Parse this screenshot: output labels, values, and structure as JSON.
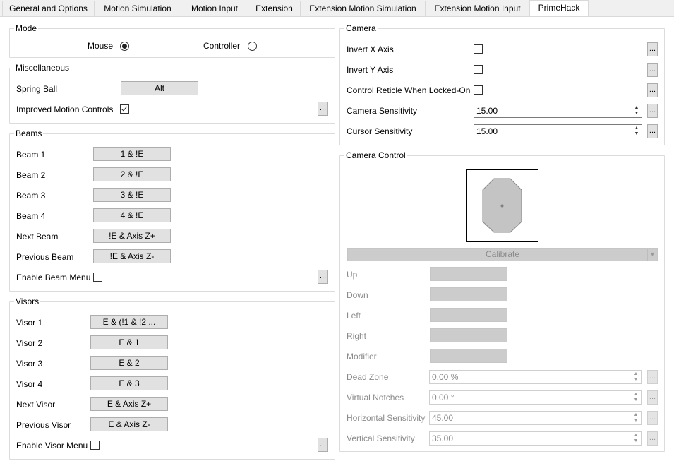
{
  "tabs": [
    {
      "label": "General and Options"
    },
    {
      "label": "Motion Simulation"
    },
    {
      "label": "Motion Input"
    },
    {
      "label": "Extension"
    },
    {
      "label": "Extension Motion Simulation"
    },
    {
      "label": "Extension Motion Input"
    },
    {
      "label": "PrimeHack"
    }
  ],
  "mode": {
    "title": "Mode",
    "mouse_label": "Mouse",
    "controller_label": "Controller",
    "selected": "Mouse"
  },
  "misc": {
    "title": "Miscellaneous",
    "spring_ball_label": "Spring Ball",
    "spring_ball_value": "Alt",
    "improved_motion_label": "Improved Motion Controls",
    "improved_motion_checked": true,
    "more_label": "..."
  },
  "beams": {
    "title": "Beams",
    "rows": [
      {
        "label": "Beam 1",
        "value": "1 & !E"
      },
      {
        "label": "Beam 2",
        "value": "2 & !E"
      },
      {
        "label": "Beam 3",
        "value": "3 & !E"
      },
      {
        "label": "Beam 4",
        "value": "4 & !E"
      },
      {
        "label": "Next Beam",
        "value": "!E & Axis Z+"
      },
      {
        "label": "Previous Beam",
        "value": "!E & Axis Z-"
      }
    ],
    "menu_label": "Enable Beam Menu",
    "menu_checked": false,
    "more_label": "..."
  },
  "visors": {
    "title": "Visors",
    "rows": [
      {
        "label": "Visor 1",
        "value": "E & (!1 & !2 ..."
      },
      {
        "label": "Visor 2",
        "value": "E & 1"
      },
      {
        "label": "Visor 3",
        "value": "E & 2"
      },
      {
        "label": "Visor 4",
        "value": "E & 3"
      },
      {
        "label": "Next Visor",
        "value": "E & Axis Z+"
      },
      {
        "label": "Previous Visor",
        "value": "E & Axis Z-"
      }
    ],
    "menu_label": "Enable Visor Menu",
    "menu_checked": false,
    "more_label": "..."
  },
  "camera": {
    "title": "Camera",
    "invert_x_label": "Invert X Axis",
    "invert_y_label": "Invert Y Axis",
    "reticle_label": "Control Reticle When Locked-On",
    "cam_sens_label": "Camera Sensitivity",
    "cam_sens_value": "15.00",
    "cursor_sens_label": "Cursor Sensitivity",
    "cursor_sens_value": "15.00",
    "more_label": "..."
  },
  "camera_control": {
    "title": "Camera Control",
    "calibrate_label": "Calibrate",
    "up_label": "Up",
    "down_label": "Down",
    "left_label": "Left",
    "right_label": "Right",
    "modifier_label": "Modifier",
    "dead_zone_label": "Dead Zone",
    "dead_zone_value": "0.00 %",
    "virtual_notches_label": "Virtual Notches",
    "virtual_notches_value": "0.00 °",
    "h_sens_label": "Horizontal Sensitivity",
    "h_sens_value": "45.00",
    "v_sens_label": "Vertical Sensitivity",
    "v_sens_value": "35.00",
    "more_label": "..."
  },
  "colors": {
    "accent_disabled": "#cccccc",
    "border": "#dcdcdc"
  }
}
